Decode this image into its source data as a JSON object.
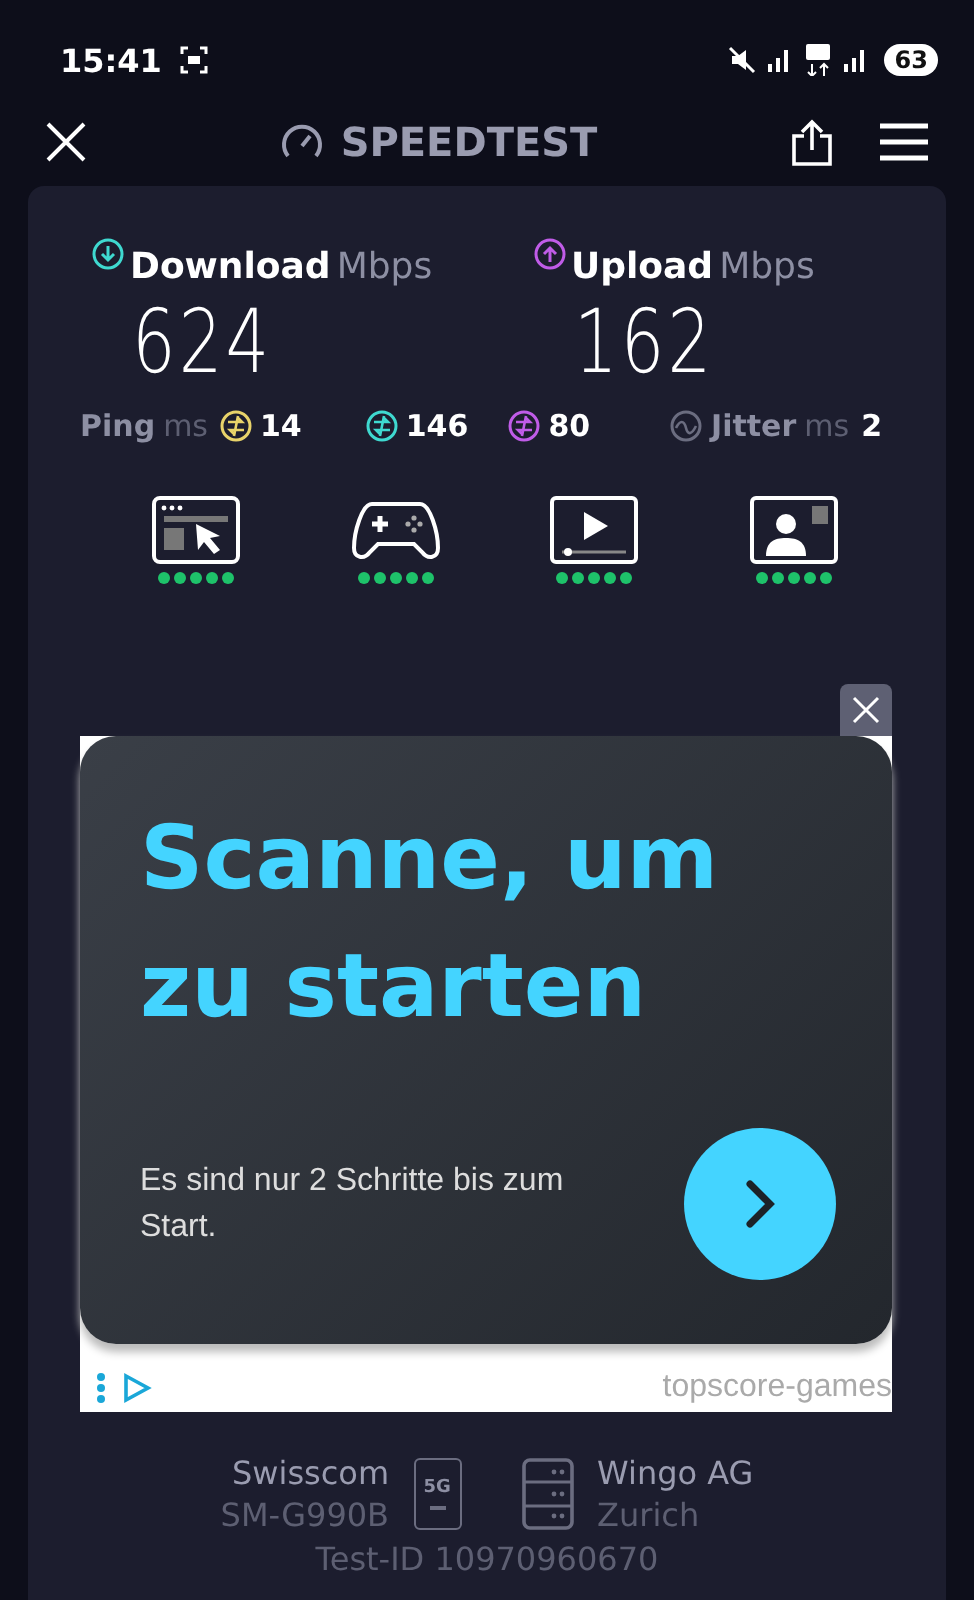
{
  "status_bar": {
    "time": "15:41",
    "battery": "63"
  },
  "header": {
    "title": "SPEEDTEST"
  },
  "results": {
    "download": {
      "label": "Download",
      "unit": "Mbps",
      "value": "624"
    },
    "upload": {
      "label": "Upload",
      "unit": "Mbps",
      "value": "162"
    },
    "ping": {
      "label": "Ping",
      "unit": "ms",
      "values": [
        {
          "value": "14",
          "color": "#e8d36a"
        },
        {
          "value": "146",
          "color": "#3fd9d0"
        },
        {
          "value": "80",
          "color": "#c05ce8"
        }
      ]
    },
    "jitter": {
      "label": "Jitter",
      "unit": "ms",
      "value": "2"
    }
  },
  "services": [
    {
      "kind": "browsing",
      "stars": 5
    },
    {
      "kind": "gaming",
      "stars": 5
    },
    {
      "kind": "video",
      "stars": 5
    },
    {
      "kind": "videocall",
      "stars": 5
    }
  ],
  "ad": {
    "headline": "Scanne, um zu starten",
    "body": "Es sind nur 2 Schritte bis zum Start.",
    "advertiser": "topscore-games"
  },
  "connection": {
    "provider": "Swisscom",
    "device": "SM-G990B",
    "network": "5G",
    "server": "Wingo AG",
    "city": "Zurich",
    "test_id": "Test-ID 10970960670"
  }
}
